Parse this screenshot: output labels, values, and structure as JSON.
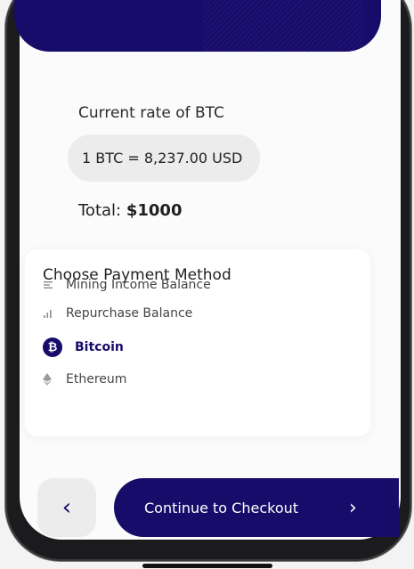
{
  "rate": {
    "label": "Current rate of BTC",
    "value": "1 BTC = 8,237.00 USD"
  },
  "total": {
    "label": "Total:",
    "amount": "$1000"
  },
  "payment": {
    "title": "Choose Payment Method",
    "methods": [
      {
        "label": "Mining Income Balance",
        "icon": "list-lines-icon",
        "selected": false
      },
      {
        "label": "Repurchase Balance",
        "icon": "signal-bars-icon",
        "selected": false
      },
      {
        "label": "Bitcoin",
        "icon": "bitcoin-icon",
        "selected": true
      },
      {
        "label": "Ethereum",
        "icon": "ethereum-icon",
        "selected": false
      }
    ]
  },
  "footer": {
    "back_icon": "chevron-left-icon",
    "cta_label": "Continue to Checkout",
    "cta_icon": "chevron-right-icon"
  },
  "colors": {
    "primary": "#180c6b",
    "pill_bg": "#ececec",
    "screen_bg": "#fbfbfb"
  }
}
